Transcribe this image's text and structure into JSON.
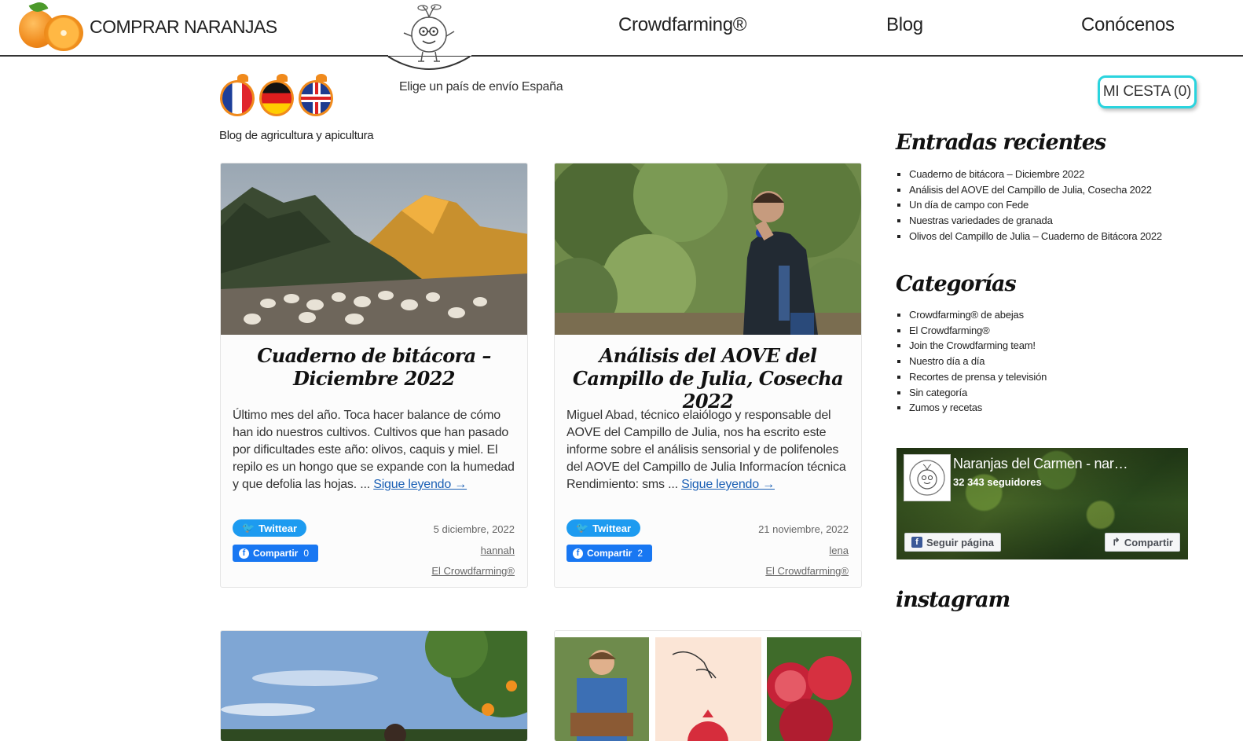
{
  "header": {
    "brand": "COMPRAR NARANJAS",
    "nav": [
      "Crowdfarming®",
      "Blog",
      "Conócenos"
    ]
  },
  "subheader": {
    "shipping": "Elige un país de envío España",
    "cart": "MI CESTA (0)",
    "tagline": "Blog de agricultura y apicultura",
    "flags": [
      "fr-flag",
      "de-flag",
      "uk-flag"
    ]
  },
  "posts": [
    {
      "title": "Cuaderno de bitácora – Diciembre 2022",
      "excerpt": "Último mes del año. Toca hacer balance de cómo han ido nuestros cultivos. Cultivos que han pasado por dificultades este año: olivos, caquis y miel. El repilo es un hongo que se expande con la humedad y que defolia las hojas. ...",
      "more": "Sigue leyendo →",
      "tweet": "Twittear",
      "share": "Compartir",
      "share_count": "0",
      "date": "5 diciembre, 2022",
      "author": "hannah",
      "category": "El Crowdfarming®"
    },
    {
      "title": "Análisis del AOVE del Campillo de Julia, Cosecha 2022",
      "excerpt": "Miguel Abad, técnico elaiólogo y responsable del AOVE del Campillo de Julia, nos ha escrito este informe sobre el análisis sensorial y de polifenoles del AOVE del Campillo de Julia Informacíon técnica Rendimiento:  sms ...",
      "more": "Sigue leyendo →",
      "tweet": "Twittear",
      "share": "Compartir",
      "share_count": "2",
      "date": "21 noviembre, 2022",
      "author": "lena",
      "category": "El Crowdfarming®"
    }
  ],
  "sidebar": {
    "recent_title": "Entradas recientes",
    "recent": [
      "Cuaderno de bitácora – Diciembre 2022",
      "Análisis del AOVE del Campillo de Julia, Cosecha 2022",
      "Un día de campo con Fede",
      "Nuestras variedades de granada",
      "Olivos del Campillo de Julia – Cuaderno de Bitácora 2022"
    ],
    "categories_title": "Categorías",
    "categories": [
      "Crowdfarming® de abejas",
      "El Crowdfarming®",
      "Join the Crowdfarming team!",
      "Nuestro día a día",
      "Recortes de prensa y televisión",
      "Sin categoría",
      "Zumos y recetas"
    ],
    "facebook": {
      "name": "Naranjas del Carmen - nar…",
      "followers": "32 343 seguidores",
      "follow": "Seguir página",
      "share": "Compartir"
    },
    "instagram_title": "instagram"
  },
  "colors": {
    "cart_border": "#2ad4de",
    "twitter": "#1d9bf0",
    "facebook": "#1877f2",
    "link": "#1a5fb4"
  }
}
